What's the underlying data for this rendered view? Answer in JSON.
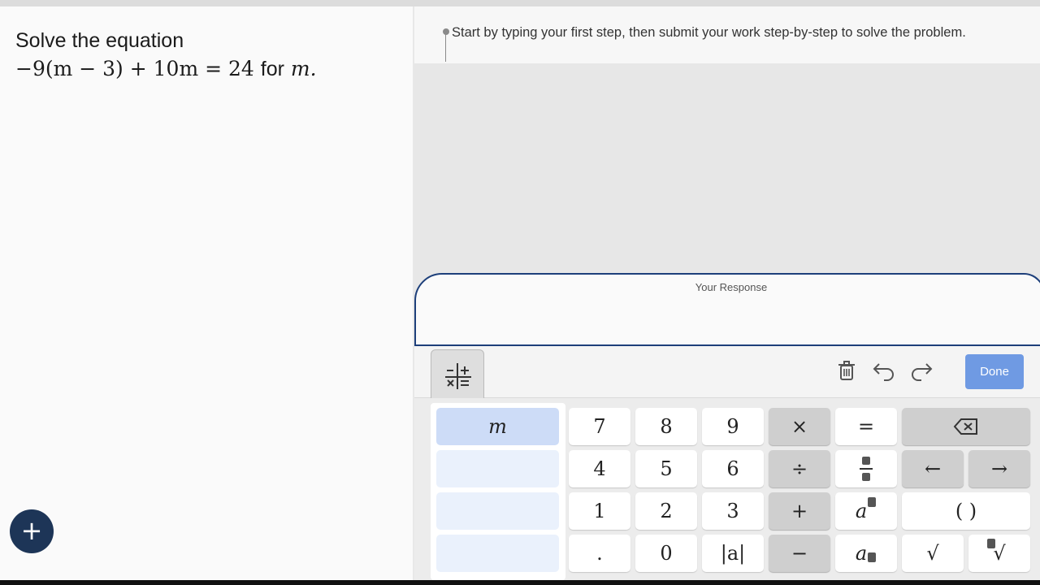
{
  "problem": {
    "title": "Solve the equation",
    "equation": "−9(m − 3) + 10m = 24",
    "for_word": "for",
    "variable": "m."
  },
  "hint": {
    "text": "Start by typing your first step, then submit your work step-by-step to solve the problem."
  },
  "response": {
    "label": "Your Response"
  },
  "toolbar": {
    "done_label": "Done",
    "icons": [
      "keypad-tab-icon",
      "trash-icon",
      "undo-icon",
      "redo-icon"
    ]
  },
  "keypad": {
    "variable_key": "m",
    "digits": {
      "k7": "7",
      "k8": "8",
      "k9": "9",
      "k4": "4",
      "k5": "5",
      "k6": "6",
      "k1": "1",
      "k2": "2",
      "k3": "3",
      "dot": ".",
      "k0": "0",
      "abs": "|a|"
    },
    "operators": {
      "times": "×",
      "divide": "÷",
      "plus": "+",
      "minus": "−",
      "equals": "=",
      "left": "←",
      "right": "→",
      "parens": "( )",
      "sqrt": "√"
    }
  },
  "colors": {
    "accent_navy": "#1d3557",
    "done_blue": "#6f9ae3",
    "variable_key": "#cddcf7"
  }
}
